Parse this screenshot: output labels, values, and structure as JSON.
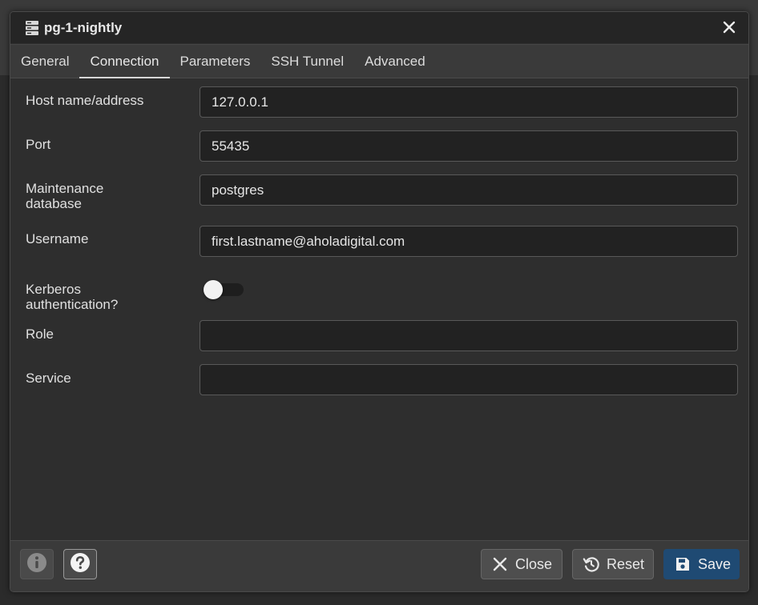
{
  "dialog": {
    "title": "pg-1-nightly",
    "title_icon": "server-icon",
    "close_icon": "close-icon"
  },
  "tabs": [
    {
      "label": "General",
      "active": false
    },
    {
      "label": "Connection",
      "active": true
    },
    {
      "label": "Parameters",
      "active": false
    },
    {
      "label": "SSH Tunnel",
      "active": false
    },
    {
      "label": "Advanced",
      "active": false
    }
  ],
  "form": {
    "host": {
      "label": "Host name/address",
      "value": "127.0.0.1"
    },
    "port": {
      "label": "Port",
      "value": "55435"
    },
    "maintenance_db": {
      "label_line1": "Maintenance",
      "label_line2": "database",
      "value": "postgres"
    },
    "username": {
      "label": "Username",
      "value": "first.lastname@aholadigital.com"
    },
    "kerberos": {
      "label_line1": "Kerberos",
      "label_line2": "authentication?",
      "enabled": false
    },
    "role": {
      "label": "Role",
      "value": ""
    },
    "service": {
      "label": "Service",
      "value": ""
    }
  },
  "footer": {
    "info_icon": "info-icon",
    "help_icon": "help-icon",
    "close_label": "Close",
    "reset_label": "Reset",
    "save_label": "Save"
  },
  "colors": {
    "save_accent": "#1f4a73",
    "background": "#2e2e2e"
  }
}
